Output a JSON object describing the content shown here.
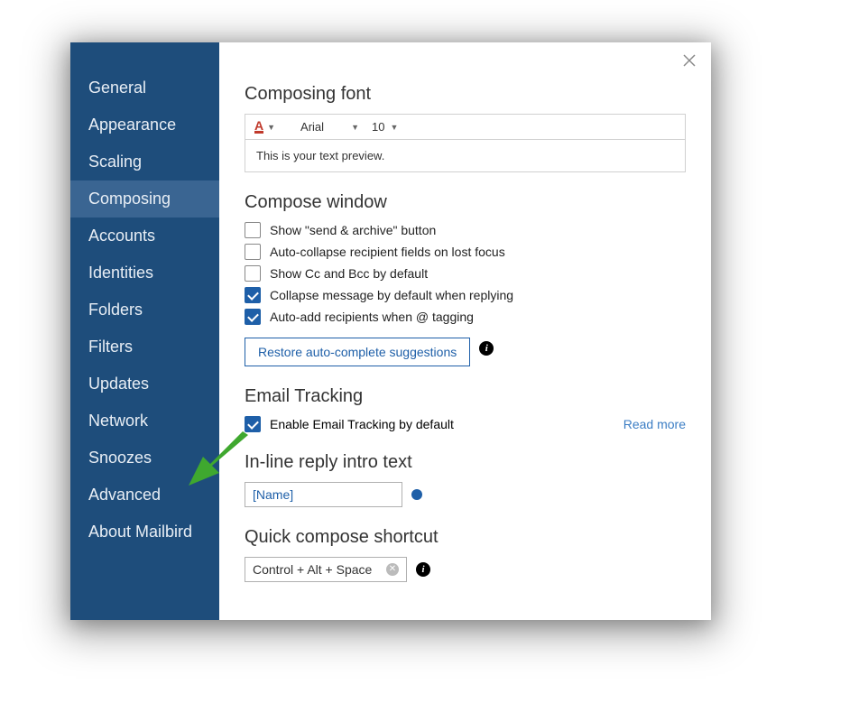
{
  "sidebar": {
    "items": [
      {
        "label": "General"
      },
      {
        "label": "Appearance"
      },
      {
        "label": "Scaling"
      },
      {
        "label": "Composing",
        "active": true
      },
      {
        "label": "Accounts"
      },
      {
        "label": "Identities"
      },
      {
        "label": "Folders"
      },
      {
        "label": "Filters"
      },
      {
        "label": "Updates"
      },
      {
        "label": "Network"
      },
      {
        "label": "Snoozes"
      },
      {
        "label": "Advanced"
      },
      {
        "label": "About Mailbird"
      }
    ]
  },
  "composingFont": {
    "title": "Composing font",
    "fontFamily": "Arial",
    "fontSize": "10",
    "preview": "This is your text preview."
  },
  "composeWindow": {
    "title": "Compose window",
    "options": [
      {
        "label": "Show \"send & archive\" button",
        "checked": false
      },
      {
        "label": "Auto-collapse recipient fields on lost focus",
        "checked": false
      },
      {
        "label": "Show Cc and Bcc by default",
        "checked": false
      },
      {
        "label": "Collapse message by default when replying",
        "checked": true
      },
      {
        "label": "Auto-add recipients when @ tagging",
        "checked": true
      }
    ],
    "restoreButton": "Restore auto-complete suggestions"
  },
  "emailTracking": {
    "title": "Email Tracking",
    "option": {
      "label": "Enable Email Tracking by default",
      "checked": true
    },
    "readMore": "Read more"
  },
  "inlineReply": {
    "title": "In-line reply intro text",
    "value": "[Name]"
  },
  "quickCompose": {
    "title": "Quick compose shortcut",
    "value": "Control + Alt + Space"
  }
}
